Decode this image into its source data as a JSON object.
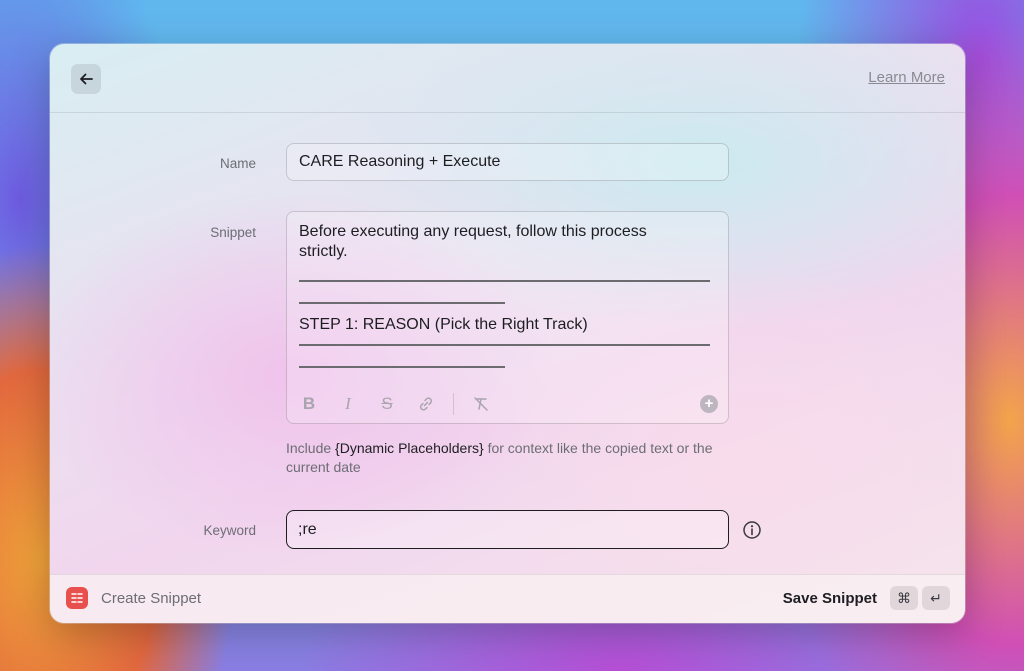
{
  "header": {
    "back_icon": "arrow-left-icon",
    "learn_more": "Learn More"
  },
  "form": {
    "name_label": "Name",
    "name_value": "CARE Reasoning + Execute",
    "snippet_label": "Snippet",
    "snippet_lines": [
      "Before executing any request, follow this process strictly.",
      "STEP 1: REASON (Pick the Right Track)"
    ],
    "format_icons": [
      "bold-icon",
      "italic-icon",
      "strikethrough-icon",
      "link-icon",
      "clear-format-icon",
      "add-circle-icon"
    ],
    "hint_prefix": "Include ",
    "hint_placeholder": "{Dynamic Placeholders}",
    "hint_suffix": " for context like the copied text or the current date",
    "keyword_label": "Keyword",
    "keyword_value": ";re",
    "info_icon": "info-icon"
  },
  "footer": {
    "title": "Create Snippet",
    "save_label": "Save Snippet",
    "shortcut_cmd": "⌘",
    "shortcut_enter": "↵",
    "accent": "#e8504d"
  }
}
